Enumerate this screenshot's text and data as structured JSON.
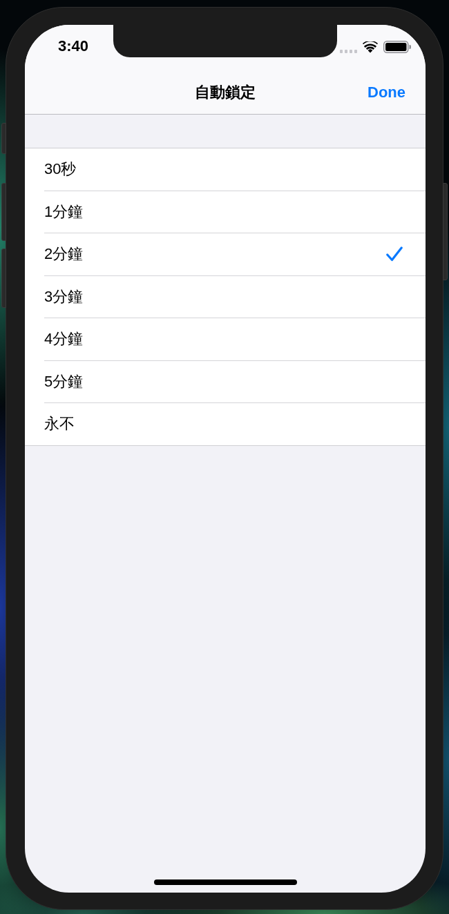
{
  "status_bar": {
    "time": "3:40"
  },
  "nav_bar": {
    "title": "自動鎖定",
    "done_button": "Done"
  },
  "options": [
    {
      "label": "30秒",
      "selected": false
    },
    {
      "label": "1分鐘",
      "selected": false
    },
    {
      "label": "2分鐘",
      "selected": true
    },
    {
      "label": "3分鐘",
      "selected": false
    },
    {
      "label": "4分鐘",
      "selected": false
    },
    {
      "label": "5分鐘",
      "selected": false
    },
    {
      "label": "永不",
      "selected": false
    }
  ]
}
